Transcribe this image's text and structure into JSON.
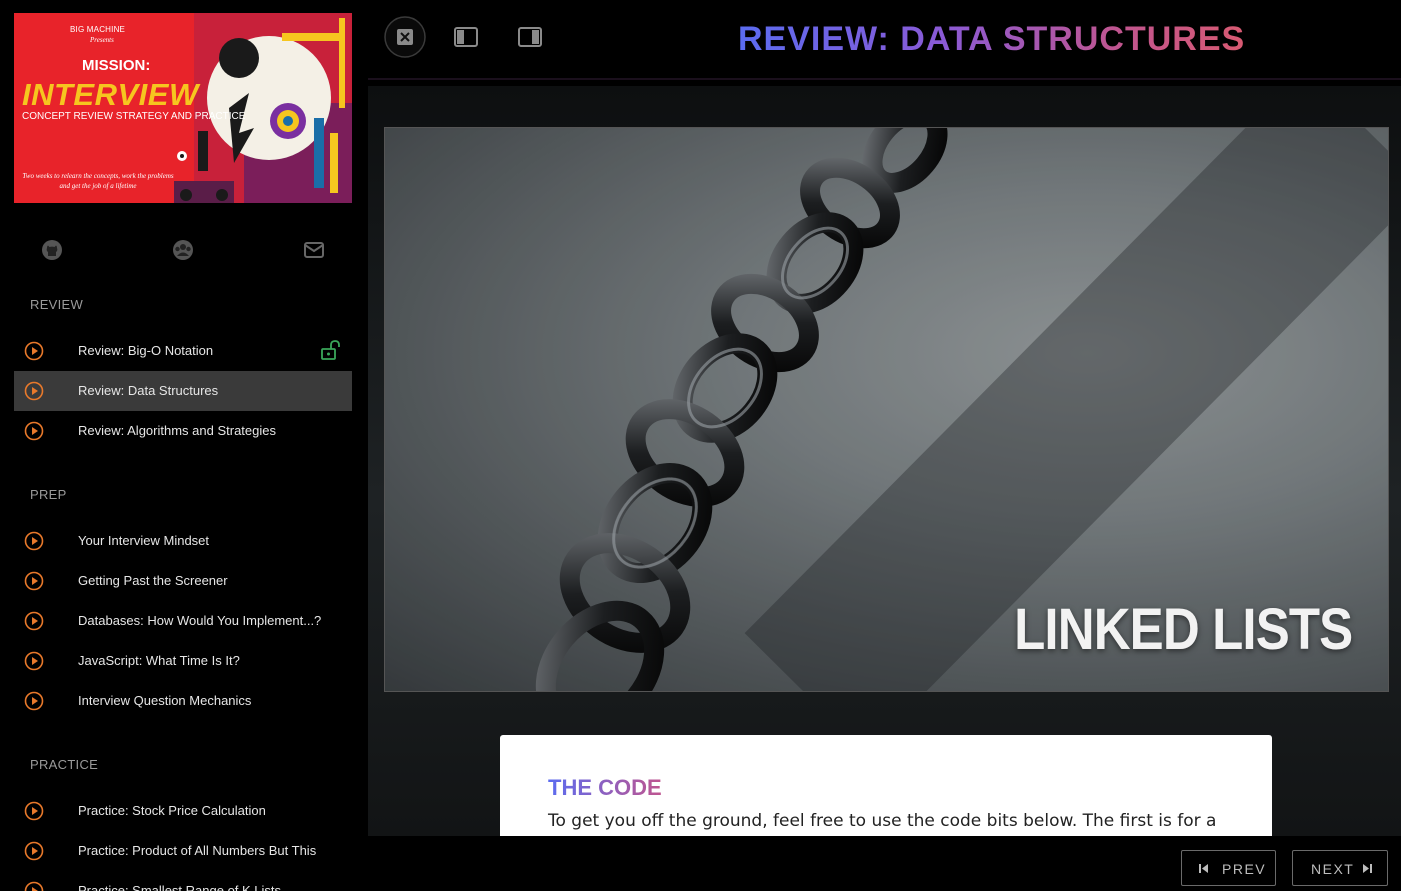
{
  "poster": {
    "brand": "BIG MACHINE",
    "presents": "Presents",
    "mission": "MISSION:",
    "title": "INTERVIEW",
    "tagline": "CONCEPT REVIEW STRATEGY AND PRACTICE",
    "blurb": "Two weeks to relearn the concepts, work the problems and get the job of a lifetime"
  },
  "social": [
    "github-icon",
    "community-icon",
    "mail-icon"
  ],
  "sidebar": {
    "sections": [
      {
        "title": "REVIEW",
        "items": [
          {
            "label": "Review: Big-O Notation",
            "unlocked": true
          },
          {
            "label": "Review: Data Structures",
            "active": true
          },
          {
            "label": "Review: Algorithms and Strategies"
          }
        ]
      },
      {
        "title": "PREP",
        "items": [
          {
            "label": "Your Interview Mindset"
          },
          {
            "label": "Getting Past the Screener"
          },
          {
            "label": "Databases: How Would You Implement...?"
          },
          {
            "label": "JavaScript: What Time Is It?"
          },
          {
            "label": "Interview Question Mechanics"
          }
        ]
      },
      {
        "title": "PRACTICE",
        "items": [
          {
            "label": "Practice: Stock Price Calculation"
          },
          {
            "label": "Practice: Product of All Numbers But This"
          },
          {
            "label": "Practice: Smallest Range of K Lists"
          }
        ]
      }
    ]
  },
  "header": {
    "title": "REVIEW: DATA STRUCTURES"
  },
  "hero": {
    "caption": "LINKED LISTS"
  },
  "card": {
    "title": "THE CODE",
    "text": "To get you off the ground, feel free to use the code bits below. The first is for a"
  },
  "nav": {
    "prev": "PREV",
    "next": "NEXT"
  },
  "colors": {
    "accent_orange": "#e8792b",
    "lock_green": "#3aa65a",
    "title_gradient_start": "#5b6cf0",
    "title_gradient_end": "#d85a72"
  }
}
